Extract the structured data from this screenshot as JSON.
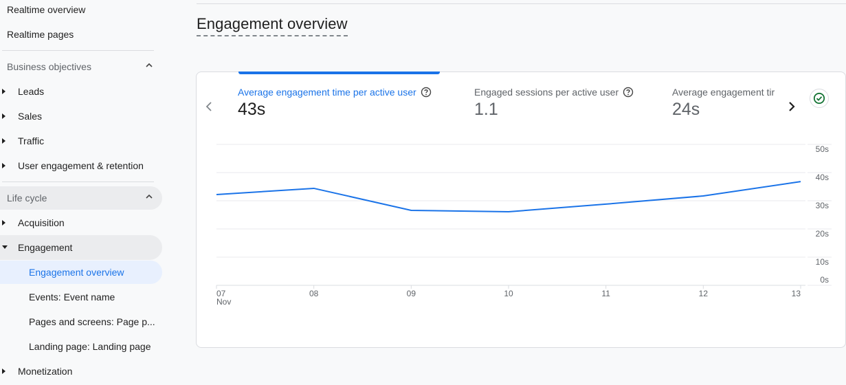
{
  "sidebar": {
    "realtime_overview": "Realtime overview",
    "realtime_pages": "Realtime pages",
    "business_objectives": {
      "label": "Business objectives",
      "items": [
        "Leads",
        "Sales",
        "Traffic",
        "User engagement & retention"
      ]
    },
    "life_cycle": {
      "label": "Life cycle",
      "acquisition": "Acquisition",
      "engagement": "Engagement",
      "engagement_children": [
        "Engagement overview",
        "Events: Event name",
        "Pages and screens: Page p...",
        "Landing page: Landing page"
      ],
      "monetization": "Monetization"
    }
  },
  "page": {
    "title": "Engagement overview"
  },
  "metrics": [
    {
      "label": "Average engagement time per active user",
      "value": "43s",
      "selected": true
    },
    {
      "label": "Engaged sessions per active user",
      "value": "1.1"
    },
    {
      "label": "Average engagement tir",
      "value": "24s"
    }
  ],
  "colors": {
    "accent": "#1a73e8",
    "check": "#137333"
  },
  "chart_data": {
    "type": "line",
    "title": "Average engagement time per active user",
    "x": [
      "07",
      "08",
      "09",
      "10",
      "11",
      "12",
      "13"
    ],
    "x_sublabel": "Nov",
    "series": [
      {
        "name": "Average engagement time per active user",
        "values": [
          32.2,
          34.4,
          26.6,
          26.1,
          28.8,
          31.7,
          36.8
        ]
      }
    ],
    "y_ticks": [
      "0s",
      "10s",
      "20s",
      "30s",
      "40s",
      "50s"
    ],
    "ylim": [
      0,
      50
    ],
    "yaxis_side": "right",
    "grid": true,
    "xlabel": "",
    "ylabel": ""
  }
}
